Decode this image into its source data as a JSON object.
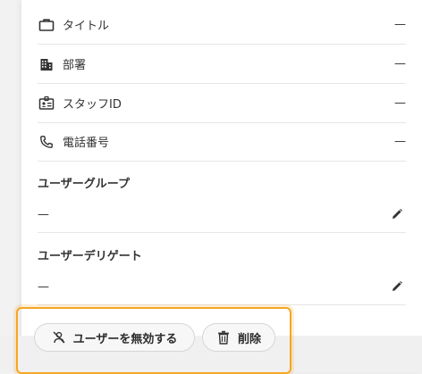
{
  "details": {
    "rows": [
      {
        "icon": "briefcase-icon",
        "label": "タイトル",
        "value": "—"
      },
      {
        "icon": "building-icon",
        "label": "部署",
        "value": "—"
      },
      {
        "icon": "id-badge-icon",
        "label": "スタッフID",
        "value": "—"
      },
      {
        "icon": "phone-icon",
        "label": "電話番号",
        "value": "—"
      }
    ]
  },
  "user_groups": {
    "title": "ユーザーグループ",
    "value": "—"
  },
  "user_delegates": {
    "title": "ユーザーデリゲート",
    "value": "—"
  },
  "actions": {
    "disable_label": "ユーザーを無効する",
    "delete_label": "削除"
  },
  "colors": {
    "highlight": "#f5a623",
    "divider": "#e6e6e6"
  }
}
